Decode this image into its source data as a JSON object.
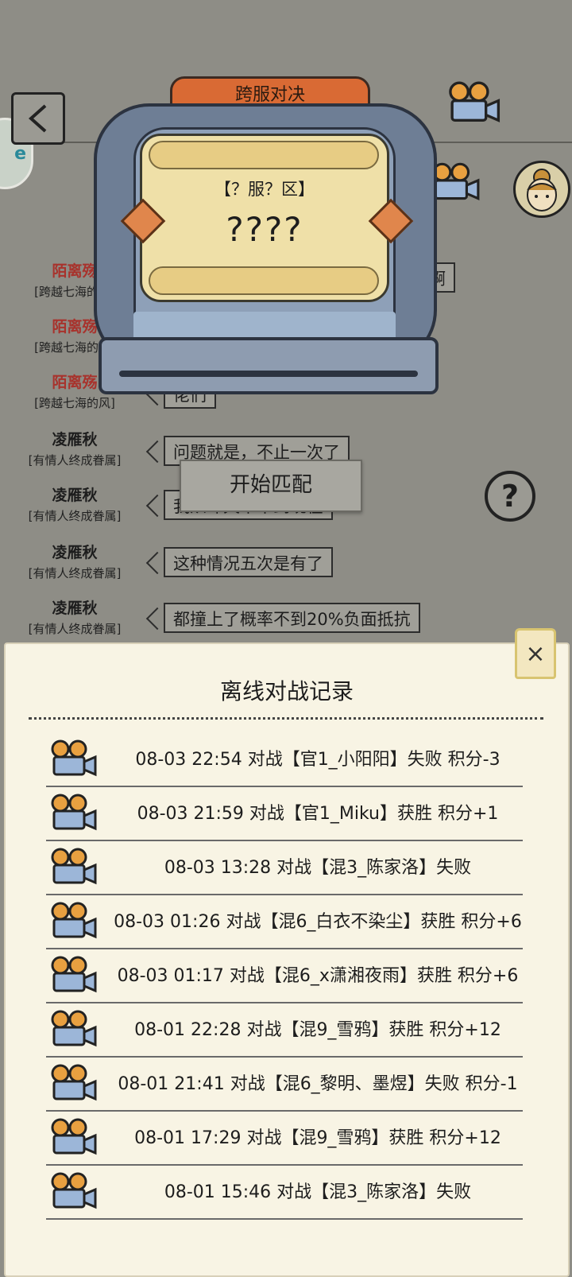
{
  "header": {
    "tab_title": "跨服对决"
  },
  "match_card": {
    "server_label": "【？服？区】",
    "player_name": "????"
  },
  "match_button_label": "开始匹配",
  "help_label": "?",
  "chat": [
    {
      "name": "陌离殇",
      "title": "[跨越七海的风]",
      "message": "啊",
      "name_color": "red"
    },
    {
      "name": "陌离殇",
      "title": "[跨越七海的风]",
      "message": "",
      "name_color": "red"
    },
    {
      "name": "陌离殇",
      "title": "[跨越七海的风]",
      "message": "佬们",
      "name_color": "red"
    },
    {
      "name": "凌雁秋",
      "title": "[有情人终成眷属]",
      "message": "问题就是，不止一次了",
      "name_color": "dark"
    },
    {
      "name": "凌雁秋",
      "title": "[有情人终成眷属]",
      "message": "我从昨天中午到现在",
      "name_color": "dark"
    },
    {
      "name": "凌雁秋",
      "title": "[有情人终成眷属]",
      "message": "这种情况五次是有了",
      "name_color": "dark"
    },
    {
      "name": "凌雁秋",
      "title": "[有情人终成眷属]",
      "message": "都撞上了概率不到20%负面抵抗",
      "name_color": "dark"
    }
  ],
  "records_panel": {
    "title": "离线对战记录",
    "close_label": "×",
    "records": [
      {
        "text": "08-03 22:54 对战【官1_小阳阳】失败 积分-3"
      },
      {
        "text": "08-03 21:59 对战【官1_Miku】获胜 积分+1"
      },
      {
        "text": "08-03 13:28 对战【混3_陈家洛】失败"
      },
      {
        "text": "08-03 01:26 对战【混6_白衣不染尘】获胜 积分+6"
      },
      {
        "text": "08-03 01:17 对战【混6_x潇湘夜雨】获胜 积分+6"
      },
      {
        "text": "08-01 22:28 对战【混9_雪鸦】获胜 积分+12"
      },
      {
        "text": "08-01 21:41 对战【混6_黎明、墨煜】失败 积分-1"
      },
      {
        "text": "08-01 17:29 对战【混9_雪鸦】获胜 积分+12"
      },
      {
        "text": "08-01 15:46 对战【混3_陈家洛】失败"
      }
    ]
  },
  "colors": {
    "background": "#8e8d86",
    "sheet": "#f8f4e4",
    "accent_orange": "#d96a34",
    "name_red": "#a8322c"
  },
  "icons": [
    "back-arrow-icon",
    "film-camera-icon",
    "avatar-icon",
    "question-icon",
    "close-icon",
    "gem-icon"
  ]
}
